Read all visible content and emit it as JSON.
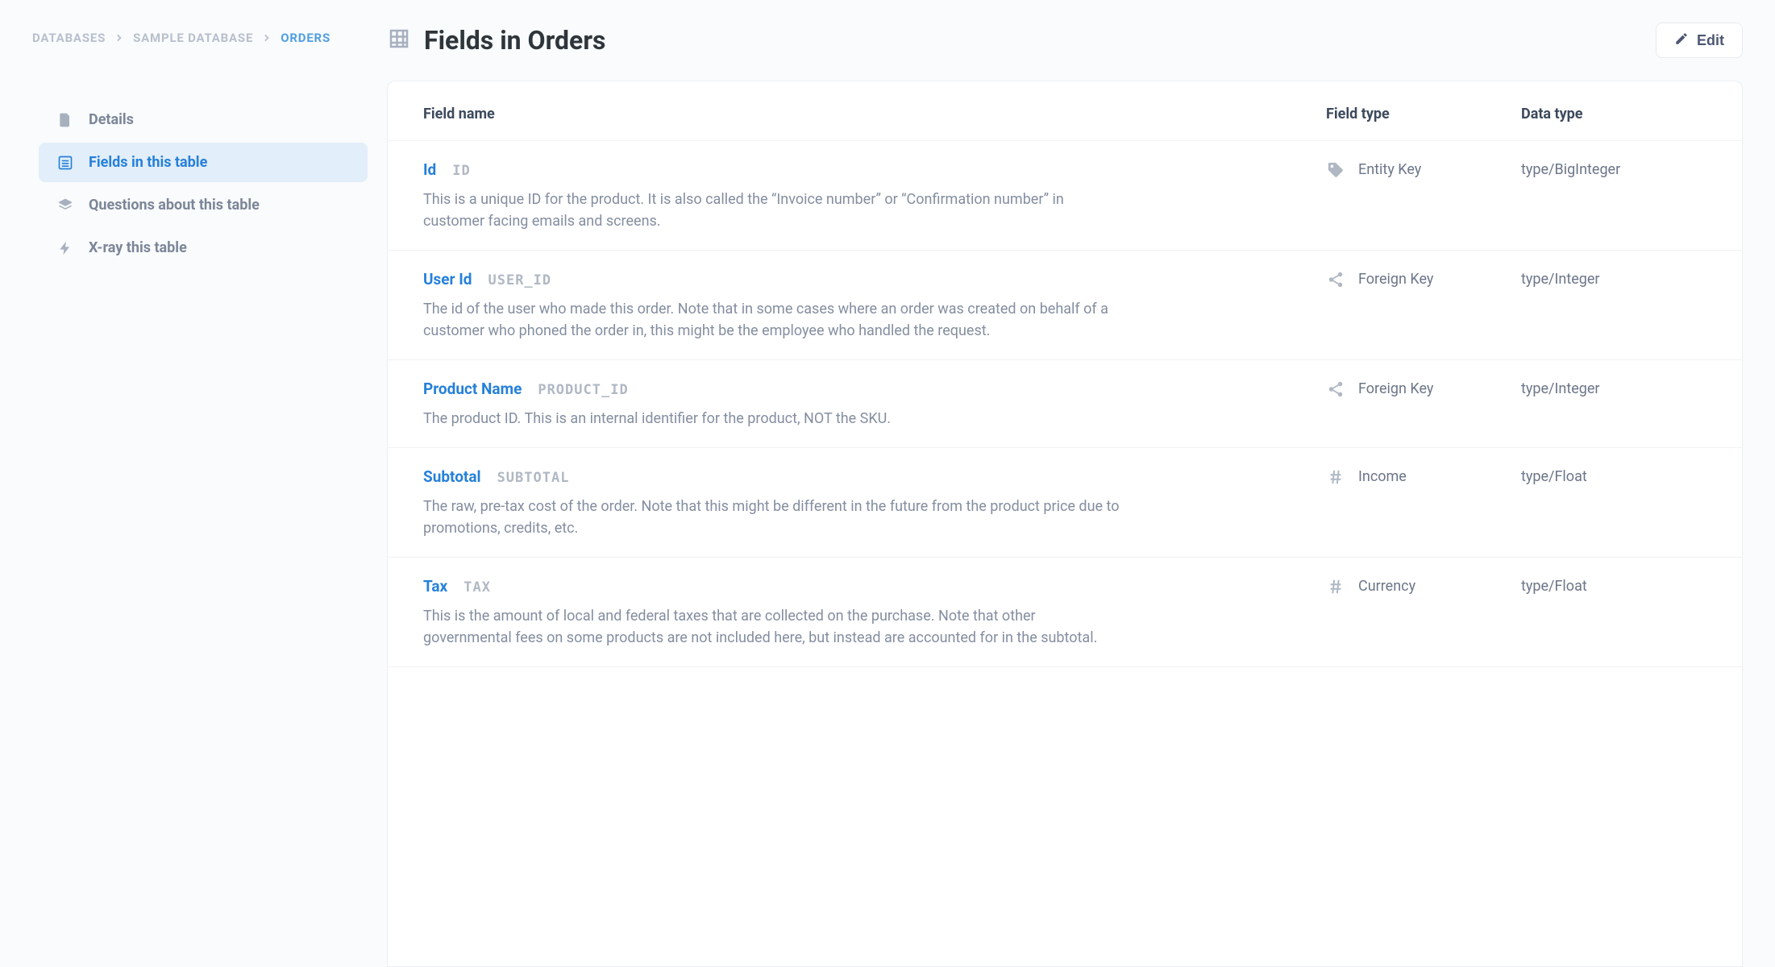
{
  "breadcrumb": {
    "items": [
      {
        "label": "DATABASES",
        "active": false
      },
      {
        "label": "SAMPLE DATABASE",
        "active": false
      },
      {
        "label": "ORDERS",
        "active": true
      }
    ]
  },
  "header": {
    "title": "Fields in Orders",
    "edit_label": "Edit"
  },
  "sidebar": {
    "items": [
      {
        "icon": "file-icon",
        "label": "Details",
        "active": false
      },
      {
        "icon": "list-icon",
        "label": "Fields in this table",
        "active": true
      },
      {
        "icon": "stack-icon",
        "label": "Questions about this table",
        "active": false
      },
      {
        "icon": "bolt-icon",
        "label": "X-ray this table",
        "active": false
      }
    ]
  },
  "table": {
    "columns": {
      "name": "Field name",
      "field_type": "Field type",
      "data_type": "Data type"
    },
    "fields": [
      {
        "name": "Id",
        "code": "ID",
        "field_type_icon": "tag-icon",
        "field_type": "Entity Key",
        "data_type": "type/BigInteger",
        "description": "This is a unique ID for the product. It is also called the “Invoice number” or “Confirmation number” in customer facing emails and screens."
      },
      {
        "name": "User Id",
        "code": "USER_ID",
        "field_type_icon": "share-icon",
        "field_type": "Foreign Key",
        "data_type": "type/Integer",
        "description": "The id of the user who made this order. Note that in some cases where an order was created on behalf of a customer who phoned the order in, this might be the employee who handled the request."
      },
      {
        "name": "Product Name",
        "code": "PRODUCT_ID",
        "field_type_icon": "share-icon",
        "field_type": "Foreign Key",
        "data_type": "type/Integer",
        "description": "The product ID. This is an internal identifier for the product, NOT the SKU."
      },
      {
        "name": "Subtotal",
        "code": "SUBTOTAL",
        "field_type_icon": "hash-icon",
        "field_type": "Income",
        "data_type": "type/Float",
        "description": "The raw, pre-tax cost of the order. Note that this might be different in the future from the product price due to promotions, credits, etc."
      },
      {
        "name": "Tax",
        "code": "TAX",
        "field_type_icon": "hash-icon",
        "field_type": "Currency",
        "data_type": "type/Float",
        "description": "This is the amount of local and federal taxes that are collected on the purchase. Note that other governmental fees on some products are not included here, but instead are accounted for in the subtotal."
      }
    ]
  }
}
